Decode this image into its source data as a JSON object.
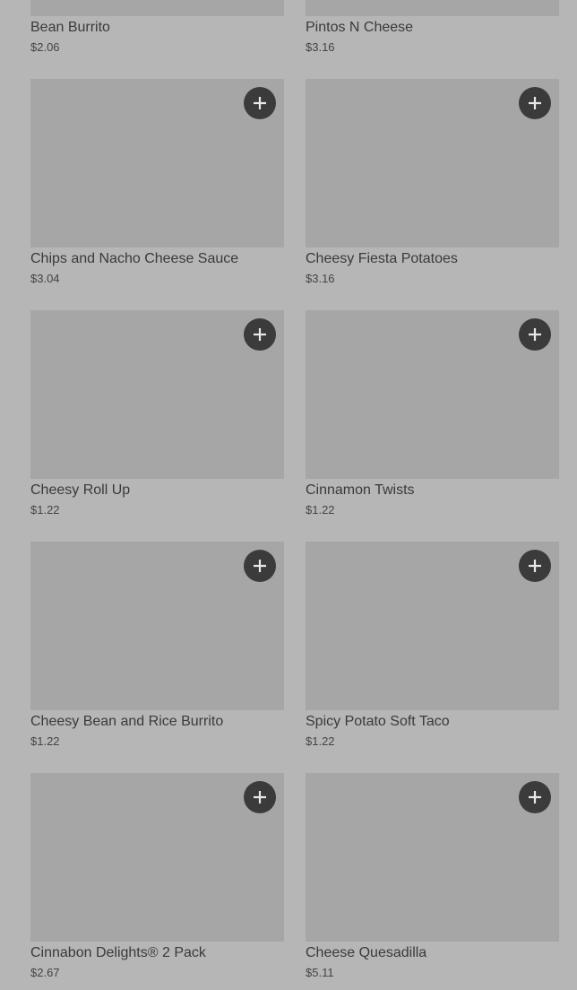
{
  "colors": {
    "background": "#b6b6b6",
    "image_placeholder": "#a6a6a6",
    "add_button": "#3b3b3b",
    "add_icon": "#e8e8e8",
    "text": "#3a3a3a"
  },
  "add_button_icon": "plus-icon",
  "rows": [
    {
      "left": {
        "name": "Bean Burrito",
        "price": "$2.06"
      },
      "right": {
        "name": "Pintos N Cheese",
        "price": "$3.16"
      }
    },
    {
      "left": {
        "name": "Chips and Nacho Cheese Sauce",
        "price": "$3.04"
      },
      "right": {
        "name": "Cheesy Fiesta Potatoes",
        "price": "$3.16"
      }
    },
    {
      "left": {
        "name": "Cheesy Roll Up",
        "price": "$1.22"
      },
      "right": {
        "name": "Cinnamon Twists",
        "price": "$1.22"
      }
    },
    {
      "left": {
        "name": "Cheesy Bean and Rice Burrito",
        "price": "$1.22"
      },
      "right": {
        "name": "Spicy Potato Soft Taco",
        "price": "$1.22"
      }
    },
    {
      "left": {
        "name": "Cinnabon Delights® 2 Pack",
        "price": "$2.67"
      },
      "right": {
        "name": "Cheese Quesadilla",
        "price": "$5.11"
      }
    }
  ]
}
